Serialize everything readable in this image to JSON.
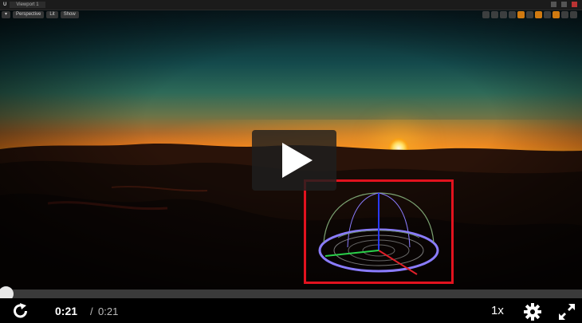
{
  "editor": {
    "tab_label": "Viewport 1",
    "viewport_buttons": [
      "Perspective",
      "Lit",
      "Show"
    ]
  },
  "player": {
    "current_time": "0:21",
    "separator": "/",
    "duration": "0:21",
    "playback_speed": "1x",
    "progress_fraction": 0.0
  },
  "colors": {
    "highlight_box": "#e2121e",
    "gizmo_x_axis": "#e0202a",
    "gizmo_y_axis": "#2ad04a",
    "gizmo_z_axis": "#2a3aff",
    "gizmo_ring": "#8a7cff"
  },
  "icons": {
    "replay": "replay-icon",
    "settings": "gear-icon",
    "fullscreen": "fullscreen-icon",
    "play": "play-icon"
  }
}
